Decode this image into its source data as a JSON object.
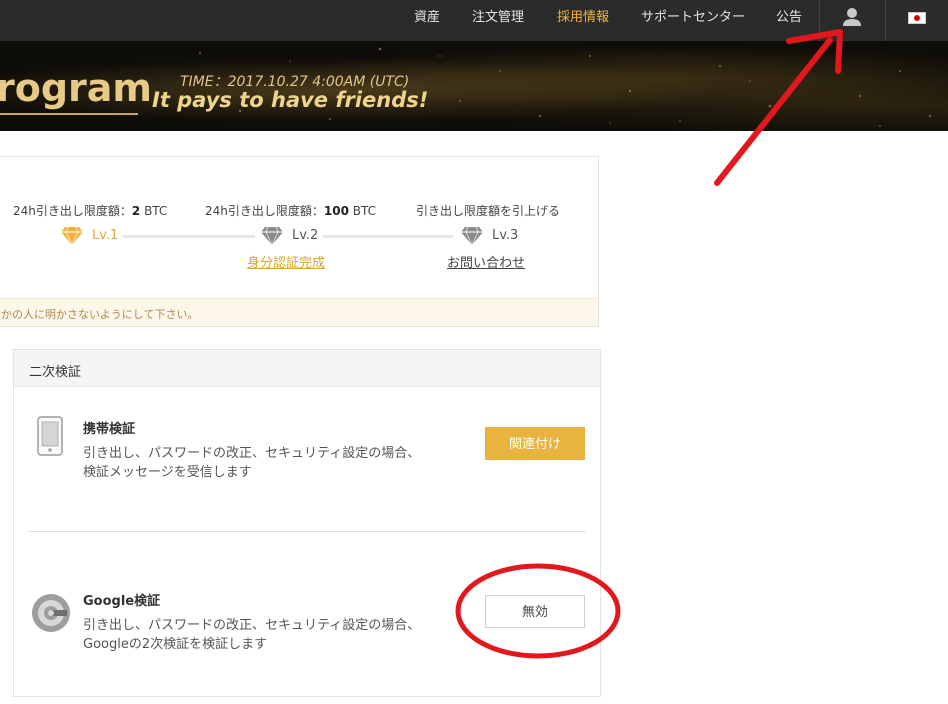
{
  "nav": {
    "items": [
      {
        "label": "資産"
      },
      {
        "label": "注文管理"
      },
      {
        "label": "採用情報"
      },
      {
        "label": "サポートセンター"
      },
      {
        "label": "公告"
      }
    ],
    "user_icon": "user-icon",
    "flag_icon": "japan-flag-icon"
  },
  "banner": {
    "title": "rogram",
    "time": "TIME：2017.10.27 4:00AM (UTC)",
    "slogan": "It pays to have friends!"
  },
  "levels": {
    "tiers": [
      {
        "caption_prefix": "24h引き出し限度額：",
        "caption_amount": "2",
        "caption_unit": " BTC",
        "label": "Lv.1",
        "link": ""
      },
      {
        "caption_prefix": "24h引き出し限度額：",
        "caption_amount": "100",
        "caption_unit": " BTC",
        "label": "Lv.2",
        "link": "身分認証完成"
      },
      {
        "caption_prefix": "引き出し限度額を引上げる",
        "caption_amount": "",
        "caption_unit": "",
        "label": "Lv.3",
        "link": "お問い合わせ"
      }
    ],
    "notice": "かの人に明かさないようにして下さい。"
  },
  "two_factor": {
    "header": "二次検証",
    "phone": {
      "title": "携帯検証",
      "desc_line1": "引き出し、パスワードの改正、セキュリティ設定の場合、",
      "desc_line2": "検証メッセージを受信します",
      "button": "関連付け"
    },
    "google": {
      "title": "Google検証",
      "desc_line1": "引き出し、パスワードの改正、セキュリティ設定の場合、",
      "desc_line2": "Googleの2次検証を検証します",
      "button": "無効"
    }
  },
  "colors": {
    "accent": "#e9b33f",
    "nav_active": "#f0b43c",
    "nav_bg": "#2b2b2b",
    "annotation": "#e3171e"
  }
}
